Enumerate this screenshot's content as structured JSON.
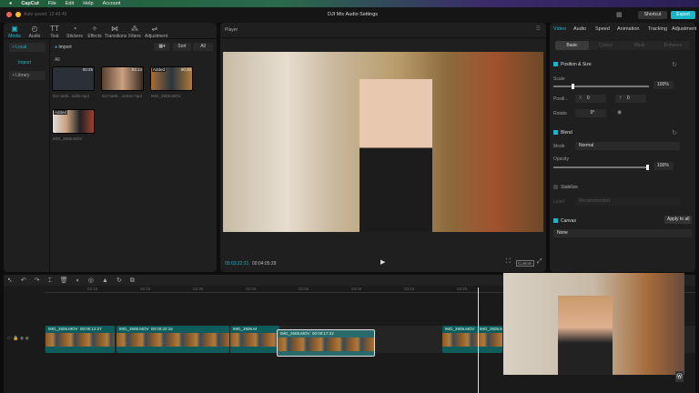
{
  "menubar": {
    "app": "CapCut",
    "items": [
      "File",
      "Edit",
      "Help",
      "Account"
    ]
  },
  "titlebar": {
    "autosave": "Auto saved: 12:49:49",
    "project": "DJI Mic Audio Settings",
    "shortcut": "Shortcut",
    "export": "Export"
  },
  "toolbar": [
    {
      "label": "Media",
      "icon": "media-icon"
    },
    {
      "label": "Audio",
      "icon": "audio-icon"
    },
    {
      "label": "Text",
      "icon": "text-icon"
    },
    {
      "label": "Stickers",
      "icon": "sticker-icon"
    },
    {
      "label": "Effects",
      "icon": "effects-icon"
    },
    {
      "label": "Transitions",
      "icon": "transitions-icon"
    },
    {
      "label": "Filters",
      "icon": "filters-icon"
    },
    {
      "label": "Adjustment",
      "icon": "adjustment-icon"
    }
  ],
  "media": {
    "local": "• Local",
    "import_side": "Import",
    "library": "• Library",
    "import": "Import",
    "sort": "Sort",
    "all_btn": "All",
    "all": "All",
    "items": [
      {
        "name": "DJI Setti...sults.mp4",
        "duration": "00:25",
        "badge": ""
      },
      {
        "name": "DJI Setti....sense.mp4",
        "duration": "03:13",
        "badge": ""
      },
      {
        "name": "IMG_2606.MOV",
        "duration": "00:20",
        "badge": "Added"
      },
      {
        "name": "IMG_2605.MOV",
        "duration": "",
        "badge": "Added"
      }
    ]
  },
  "player": {
    "title": "Player",
    "current": "00:03:22:21",
    "total": "00:04:05:29",
    "ratio": "Custom"
  },
  "inspector": {
    "tabs": [
      "Video",
      "Audio",
      "Speed",
      "Animation",
      "Tracking",
      "Adjustment"
    ],
    "subtabs": [
      "Basic",
      "Cutout",
      "Mask",
      "Enhance"
    ],
    "position_size": "Position & Size",
    "scale_label": "Scale",
    "scale": "100%",
    "scale_value": 100,
    "position_label": "Positi...",
    "x_label": "X",
    "x": "0",
    "y_label": "Y",
    "y": "0",
    "rotate_label": "Rotate",
    "rotate": "0°",
    "blend": "Blend",
    "mode_label": "Mode",
    "mode": "Normal",
    "opacity_label": "Opacity",
    "opacity": "100%",
    "opacity_value": 100,
    "stabilize": "Stabilize",
    "level_label": "Level",
    "level": "Recommended",
    "canvas": "Canvas",
    "apply_all": "Apply to all",
    "canvas_value": "None"
  },
  "timeline": {
    "ticks": [
      "02:10",
      "02:20",
      "02:30",
      "02:40",
      "02:50",
      "03:00",
      "03:10",
      "03:20"
    ],
    "clips": [
      {
        "name": "IMG_2606.MOV",
        "duration": "00:00:12:27"
      },
      {
        "name": "IMG_2606.MOV",
        "duration": "00:00:22:15"
      },
      {
        "name": "IMG_2606.M",
        "duration": ""
      },
      {
        "name": "IMG_2606.MOV",
        "duration": "00:00:17:22"
      },
      {
        "name": "IMG_2605.MOV",
        "duration": ""
      },
      {
        "name": "IMG_2605.M",
        "duration": ""
      }
    ]
  },
  "colors": {
    "accent": "#1fb5c9",
    "clip": "#0f5c5c",
    "panel": "#1f1f1f"
  }
}
